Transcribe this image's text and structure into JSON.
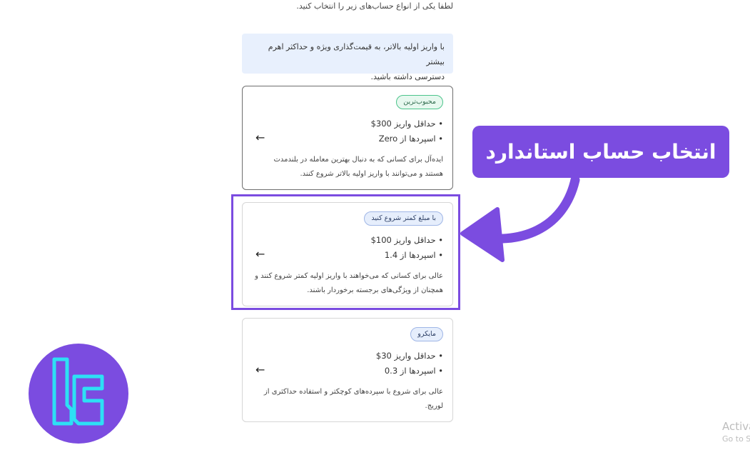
{
  "intro_text": "لطفا یکی از انواع حساب‌های زیر را انتخاب کنید.",
  "info_box": {
    "line1": "با واریز اولیه بالاتر، به قیمت‌گذاری ویژه و حداکثر اهرم بیشتر",
    "line2": "دسترسی داشته باشید."
  },
  "cards": [
    {
      "badge": "محبوب‌ترین",
      "min_deposit": "• حداقل واریز 300$",
      "spread": "• اسپردها از Zero",
      "desc1": "ایده‌آل برای کسانی که به دنبال بهترین معامله در بلندمدت",
      "desc2": "هستند و می‌توانند با واریز اولیه بالاتر شروع کنند.",
      "arrow": "←"
    },
    {
      "badge": "با مبلغ کمتر شروع کنید",
      "min_deposit": "• حداقل واریز 100$",
      "spread": "• اسپردها از 1.4",
      "desc1": "عالی برای کسانی که می‌خواهند با واریز اولیه کمتر شروع کنند و",
      "desc2": "همچنان از ویژگی‌های برجسته برخوردار باشند.",
      "arrow": "←"
    },
    {
      "badge": "مایکرو",
      "min_deposit": "• حداقل واریز 30$",
      "spread": "• اسپردها از 0.3",
      "desc1": "عالی برای شروع با سپرده‌های کوچکتر و استفاده حداکثری از",
      "desc2": "لوریج.",
      "arrow": "←"
    }
  ],
  "callout": "انتخاب حساب استاندارد",
  "watermark": {
    "line1": "Activa",
    "line2": "Go to S"
  },
  "colors": {
    "accent": "#7b4ce0",
    "info_bg": "#e8f0fd",
    "logo_cyan": "#2de0f5",
    "badge_green": "#4cc48b"
  },
  "icons": {
    "card_arrow": "arrow-left-icon",
    "logo": "tl-logo-icon"
  }
}
